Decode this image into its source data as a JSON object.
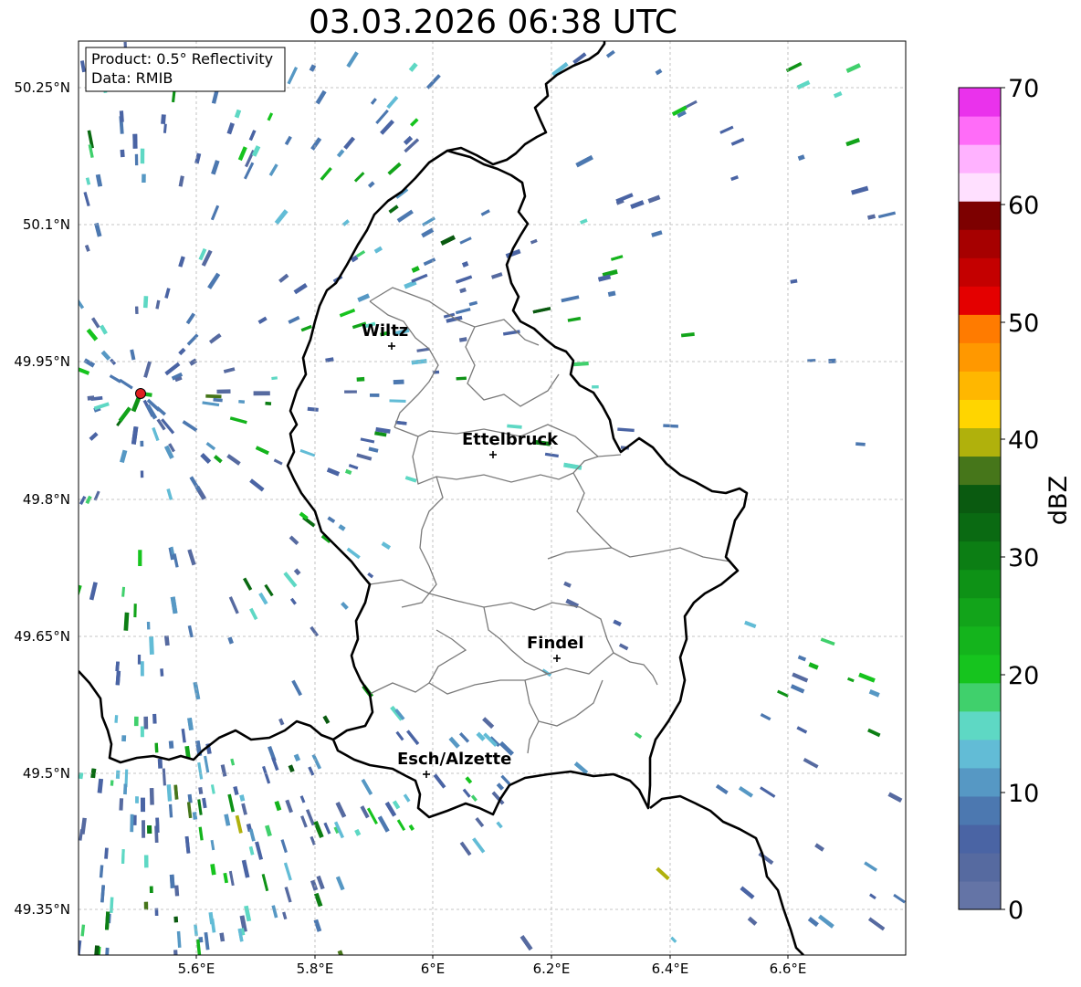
{
  "title": "03.03.2026 06:38 UTC",
  "info": {
    "product": "Product: 0.5° Reflectivity",
    "source": "Data: RMIB"
  },
  "axes": {
    "lon_ticks": [
      "5.6°E",
      "5.8°E",
      "6°E",
      "6.2°E",
      "6.4°E",
      "6.6°E"
    ],
    "lat_ticks": [
      "50.25°N",
      "50.1°N",
      "49.95°N",
      "49.8°N",
      "49.65°N",
      "49.5°N",
      "49.35°N"
    ]
  },
  "colorbar": {
    "label": "dBZ",
    "ticks": [
      "0",
      "10",
      "20",
      "30",
      "40",
      "50",
      "60",
      "70"
    ],
    "colors": [
      "#6474a6",
      "#566aa0",
      "#4a64a4",
      "#4c78b0",
      "#5698c4",
      "#62bcd6",
      "#5ed8c4",
      "#40d06c",
      "#16c41e",
      "#14b41c",
      "#12a41a",
      "#0e9216",
      "#0c7e14",
      "#0a6a12",
      "#0a5a10",
      "#46761a",
      "#b0b10c",
      "#ffd500",
      "#ffb700",
      "#ff9800",
      "#ff7b00",
      "#e40000",
      "#c40000",
      "#a60000",
      "#7d0000",
      "#ffe0ff",
      "#ffb2ff",
      "#ff6cf8",
      "#ea32ec"
    ]
  },
  "places": {
    "wiltz": "Wiltz",
    "ettelbruck": "Ettelbruck",
    "findel": "Findel",
    "esch": "Esch/Alzette"
  },
  "radar_site": {
    "lon": 5.505,
    "lat": 49.914
  }
}
